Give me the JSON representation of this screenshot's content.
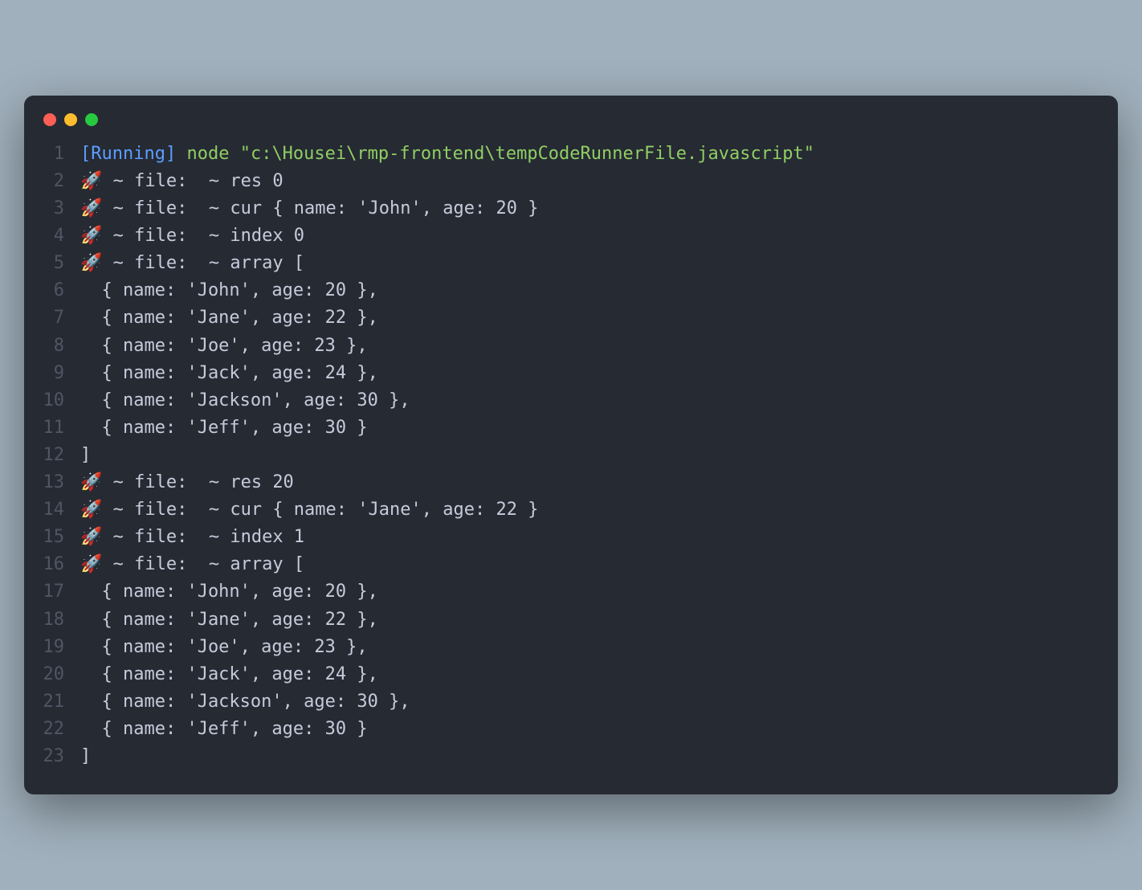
{
  "colors": {
    "background": "#262a33",
    "pageBackground": "#a0b0bc",
    "lineNumber": "#4f5663",
    "text": "#c4cbda",
    "running": "#5c9dff",
    "command": "#8fce63",
    "dotRed": "#ff5f56",
    "dotYellow": "#ffbd2e",
    "dotGreen": "#27c93f"
  },
  "header": {
    "runningLabel": "[Running]",
    "command": "node",
    "path": "\"c:\\Housei\\rmp-frontend\\tempCodeRunnerFile.javascript\""
  },
  "lines": [
    {
      "num": "1",
      "type": "header"
    },
    {
      "num": "2",
      "type": "plain",
      "text": "🚀 ~ file:  ~ res 0"
    },
    {
      "num": "3",
      "type": "plain",
      "text": "🚀 ~ file:  ~ cur { name: 'John', age: 20 }"
    },
    {
      "num": "4",
      "type": "plain",
      "text": "🚀 ~ file:  ~ index 0"
    },
    {
      "num": "5",
      "type": "plain",
      "text": "🚀 ~ file:  ~ array ["
    },
    {
      "num": "6",
      "type": "plain",
      "text": "  { name: 'John', age: 20 },"
    },
    {
      "num": "7",
      "type": "plain",
      "text": "  { name: 'Jane', age: 22 },"
    },
    {
      "num": "8",
      "type": "plain",
      "text": "  { name: 'Joe', age: 23 },"
    },
    {
      "num": "9",
      "type": "plain",
      "text": "  { name: 'Jack', age: 24 },"
    },
    {
      "num": "10",
      "type": "plain",
      "text": "  { name: 'Jackson', age: 30 },"
    },
    {
      "num": "11",
      "type": "plain",
      "text": "  { name: 'Jeff', age: 30 }"
    },
    {
      "num": "12",
      "type": "plain",
      "text": "]"
    },
    {
      "num": "13",
      "type": "plain",
      "text": "🚀 ~ file:  ~ res 20"
    },
    {
      "num": "14",
      "type": "plain",
      "text": "🚀 ~ file:  ~ cur { name: 'Jane', age: 22 }"
    },
    {
      "num": "15",
      "type": "plain",
      "text": "🚀 ~ file:  ~ index 1"
    },
    {
      "num": "16",
      "type": "plain",
      "text": "🚀 ~ file:  ~ array ["
    },
    {
      "num": "17",
      "type": "plain",
      "text": "  { name: 'John', age: 20 },"
    },
    {
      "num": "18",
      "type": "plain",
      "text": "  { name: 'Jane', age: 22 },"
    },
    {
      "num": "19",
      "type": "plain",
      "text": "  { name: 'Joe', age: 23 },"
    },
    {
      "num": "20",
      "type": "plain",
      "text": "  { name: 'Jack', age: 24 },"
    },
    {
      "num": "21",
      "type": "plain",
      "text": "  { name: 'Jackson', age: 30 },"
    },
    {
      "num": "22",
      "type": "plain",
      "text": "  { name: 'Jeff', age: 30 }"
    },
    {
      "num": "23",
      "type": "plain",
      "text": "]"
    }
  ]
}
